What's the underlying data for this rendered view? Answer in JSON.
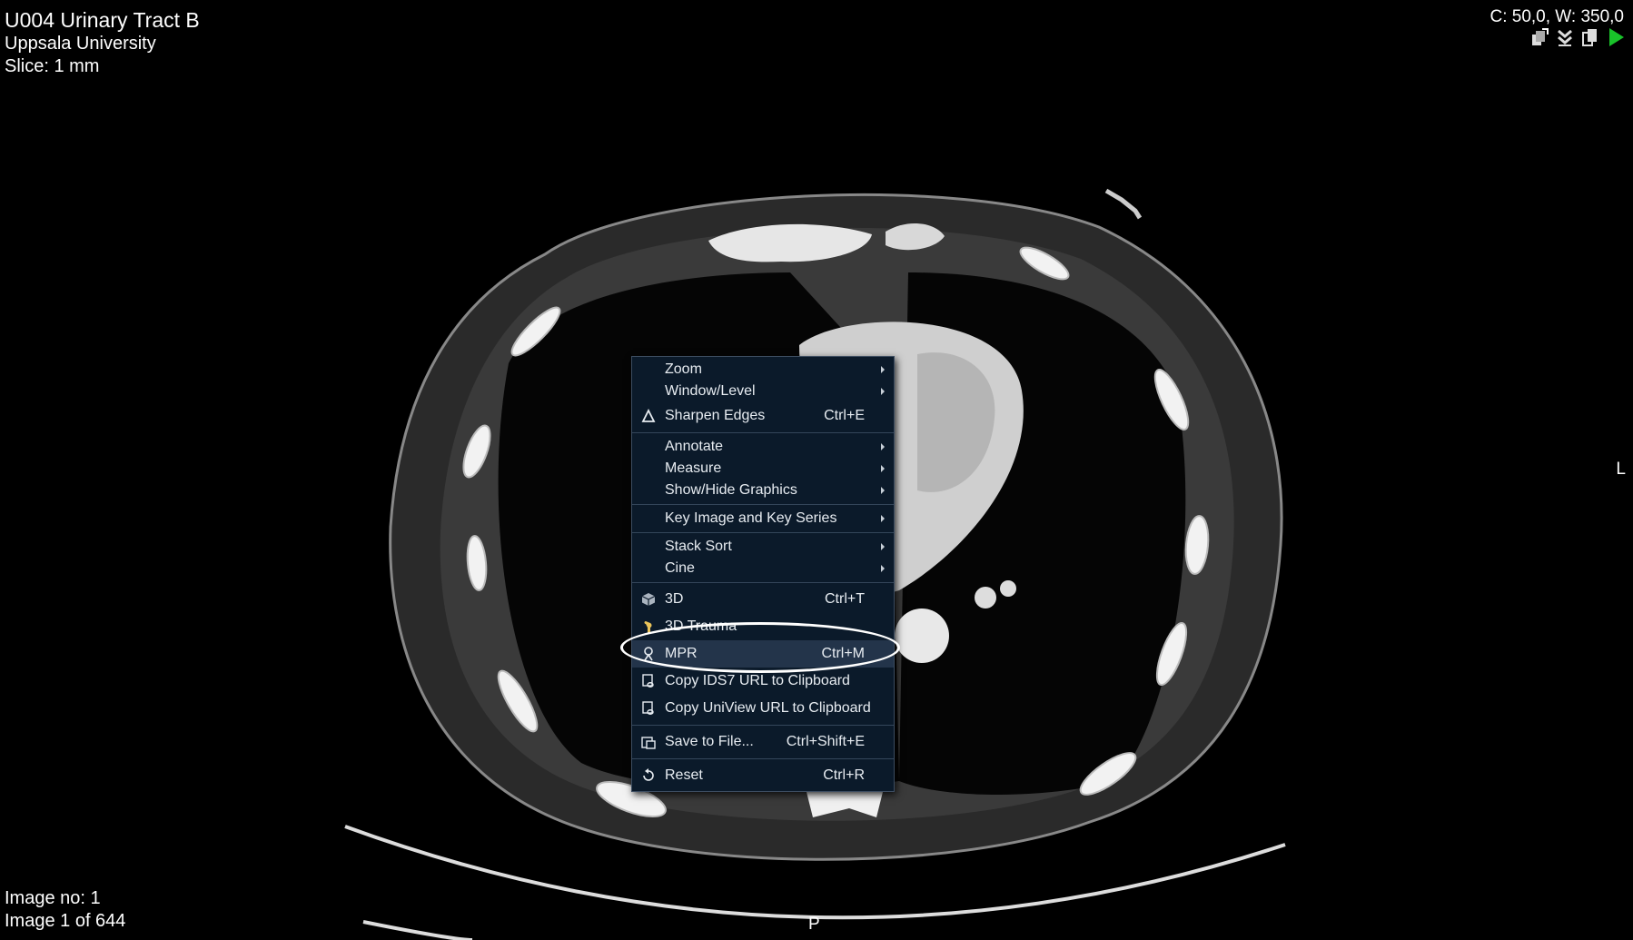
{
  "overlay": {
    "title": "U004 Urinary Tract B",
    "institution": "Uppsala University",
    "slice": "Slice: 1 mm",
    "window": "C: 50,0, W: 350,0",
    "image_no": "Image no: 1",
    "image_count": "Image 1 of 644",
    "orient_bottom": "P",
    "orient_right": "L"
  },
  "toolbar_icons": [
    "stack-icon",
    "download-icon",
    "copy-icon",
    "play-icon"
  ],
  "menu": {
    "zoom": "Zoom",
    "window_level": "Window/Level",
    "sharpen": "Sharpen Edges",
    "sharpen_sc": "Ctrl+E",
    "annotate": "Annotate",
    "measure": "Measure",
    "show_hide": "Show/Hide Graphics",
    "key_image": "Key Image and Key Series",
    "stack_sort": "Stack Sort",
    "cine": "Cine",
    "three_d": "3D",
    "three_d_sc": "Ctrl+T",
    "trauma": "3D Trauma",
    "mpr": "MPR",
    "mpr_sc": "Ctrl+M",
    "copy_ids7": "Copy IDS7 URL to Clipboard",
    "copy_uniview": "Copy UniView URL to Clipboard",
    "save": "Save to File...",
    "save_sc": "Ctrl+Shift+E",
    "reset": "Reset",
    "reset_sc": "Ctrl+R"
  },
  "colors": {
    "menu_bg": "#0b1a2a",
    "menu_highlight": "#23344a",
    "play": "#19c22a"
  }
}
